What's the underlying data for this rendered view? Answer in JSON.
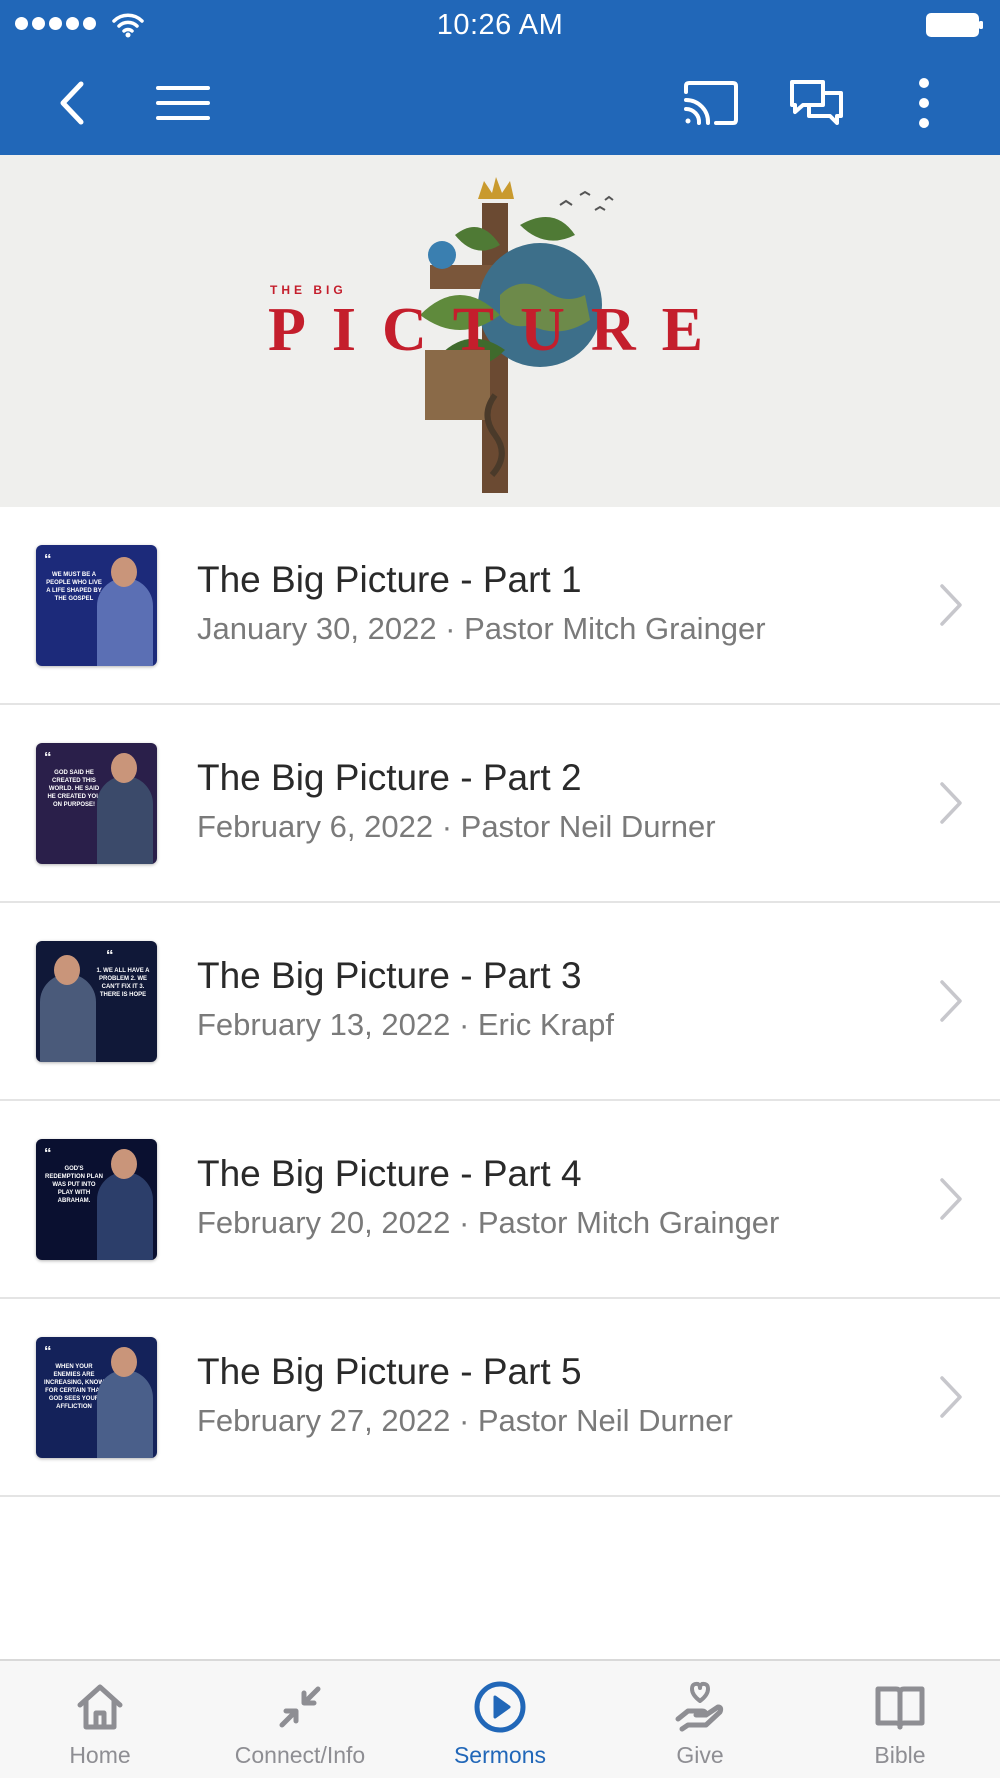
{
  "status_bar": {
    "time": "10:26 AM",
    "signal_icon": "signal-dots-icon",
    "wifi_icon": "wifi-icon",
    "battery_icon": "battery-icon"
  },
  "nav_bar": {
    "back_icon": "chevron-left-icon",
    "menu_icon": "hamburger-menu-icon",
    "cast_icon": "cast-icon",
    "chat_icon": "chat-bubbles-icon",
    "more_icon": "more-vertical-icon",
    "background_color": "#2167b8"
  },
  "banner": {
    "small_text": "THE BIG",
    "title": "PICTURE",
    "accent_color": "#c41e2c"
  },
  "sermons": [
    {
      "title": "The Big Picture - Part 1",
      "subtitle": "January 30, 2022 · Pastor Mitch Grainger",
      "thumb_text": "WE MUST BE A PEOPLE WHO LIVE A LIFE SHAPED BY THE GOSPEL"
    },
    {
      "title": "The Big Picture - Part 2",
      "subtitle": "February 6, 2022 · Pastor Neil Durner",
      "thumb_text": "GOD SAID HE CREATED THIS WORLD. HE SAID HE CREATED YOU ON PURPOSE!"
    },
    {
      "title": "The Big Picture - Part 3",
      "subtitle": "February 13, 2022 · Eric Krapf",
      "thumb_text": "1. WE ALL HAVE A PROBLEM 2. WE CAN'T FIX IT 3. THERE IS HOPE"
    },
    {
      "title": "The Big Picture - Part 4",
      "subtitle": "February 20, 2022 · Pastor Mitch Grainger",
      "thumb_text": "GOD'S REDEMPTION PLAN WAS PUT INTO PLAY WITH ABRAHAM."
    },
    {
      "title": "The Big Picture - Part 5",
      "subtitle": "February 27, 2022 · Pastor Neil Durner",
      "thumb_text": "WHEN YOUR ENEMIES ARE INCREASING, KNOW FOR CERTAIN THAT GOD SEES YOUR AFFLICTION"
    }
  ],
  "tabs": [
    {
      "label": "Home",
      "icon": "home-icon",
      "active": false
    },
    {
      "label": "Connect/Info",
      "icon": "arrows-inward-icon",
      "active": false
    },
    {
      "label": "Sermons",
      "icon": "play-circle-icon",
      "active": true
    },
    {
      "label": "Give",
      "icon": "hand-heart-icon",
      "active": false
    },
    {
      "label": "Bible",
      "icon": "open-book-icon",
      "active": false
    }
  ],
  "colors": {
    "active_tab": "#2167b8",
    "inactive_tab": "#8e8e93"
  }
}
